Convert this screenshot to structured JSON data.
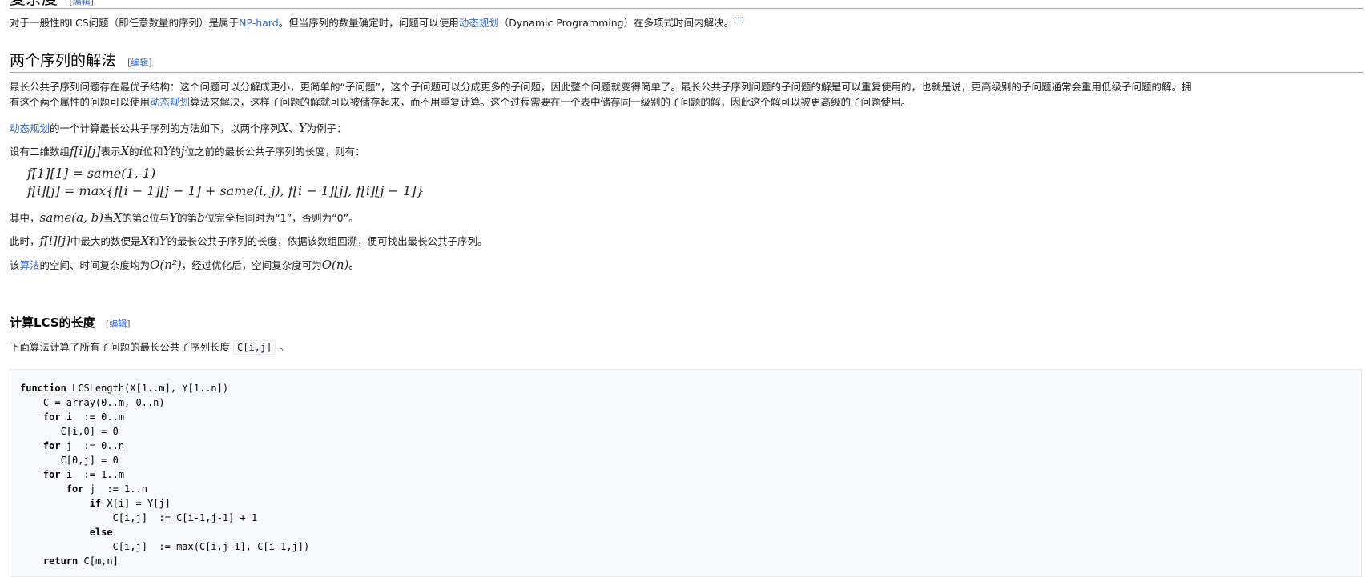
{
  "prev_heading": {
    "title": "复杂度",
    "edit": "编辑"
  },
  "complexity_para": {
    "t1": "对于一般性的LCS问题（即任意数量的序列）是属于",
    "link1": "NP-hard",
    "t2": "。但当序列的数量确定时，问题可以使用",
    "link2": "动态规划",
    "t3": "（Dynamic Programming）在多项式时间内解决。",
    "ref": "[1]"
  },
  "section2": {
    "title": "两个序列的解法",
    "edit": "编辑"
  },
  "para_structure": {
    "t1": "最长公共子序列问题存在最优子结构：这个问题可以分解成更小，更简单的“子问题”，这个子问题可以分成更多的子问题，因此整个问题就变得简单了。最长公共子序列问题的子问题的解是可以重复使用的，也就是说，更高级别的子问题通常会重用低级子问题的解。拥",
    "t2": "有这个两个属性的问题可以使用",
    "link": "动态规划",
    "t3": "算法来解决，这样子问题的解就可以被储存起来，而不用重复计算。这个过程需要在一个表中储存同一级别的子问题的解，因此这个解可以被更高级的子问题使用。"
  },
  "para_method": {
    "link": "动态规划",
    "t1": "的一个计算最长公共子序列的方法如下，以两个序列",
    "m1": "X",
    "t2": "、",
    "m2": "Y",
    "t3": "为例子："
  },
  "para_array": {
    "t1": "设有二维数组",
    "m1": "f[i][j]",
    "t2": "表示",
    "m2": "X",
    "t3": "的",
    "m3": "i",
    "t4": "位和",
    "m4": "Y",
    "t5": "的",
    "m5": "j",
    "t6": "位之前的最长公共子序列的长度，则有："
  },
  "formula": {
    "line1": "f[1][1] = same(1, 1)",
    "line2": "f[i][j] = max{f[i − 1][j − 1] + same(i, j), f[i − 1][j], f[i][j − 1]}"
  },
  "para_same": {
    "t1": "其中，",
    "m1": "same(a, b)",
    "t2": "当",
    "m2": "X",
    "t3": "的第",
    "m3": "a",
    "t4": "位与",
    "m4": "Y",
    "t5": "的第",
    "m5": "b",
    "t6": "位完全相同时为“1”，否则为“0”。"
  },
  "para_max": {
    "t1": "此时，",
    "m1": "f[i][j]",
    "t2": "中最大的数便是",
    "m2": "X",
    "t3": "和",
    "m3": "Y",
    "t4": "的最长公共子序列的长度，依据该数组回溯，便可找出最长公共子序列。"
  },
  "para_complexity": {
    "t1": "该",
    "link": "算法",
    "t2": "的空间、时间复杂度均为",
    "m1": "O(n²)",
    "t3": "，经过优化后，空间复杂度可为",
    "m2": "O(n)",
    "t4": "。"
  },
  "section3": {
    "title": "计算LCS的长度",
    "edit": "编辑"
  },
  "para_calc": {
    "t1": "下面算法计算了所有子问题的最长公共子序列长度",
    "code": "C[i,j]",
    "t2": "。"
  },
  "code_lines": [
    {
      "kw": "function",
      "rest": " LCSLength(X[1..m], Y[1..n])",
      "indent": ""
    },
    {
      "kw": "",
      "rest": "C = array(0..m, 0..n)",
      "indent": "    "
    },
    {
      "kw": "for",
      "rest": " i  := 0..m",
      "indent": "    "
    },
    {
      "kw": "",
      "rest": "C[i,0] = 0",
      "indent": "       "
    },
    {
      "kw": "for",
      "rest": " j  := 0..n",
      "indent": "    "
    },
    {
      "kw": "",
      "rest": "C[0,j] = 0",
      "indent": "       "
    },
    {
      "kw": "for",
      "rest": " i  := 1..m",
      "indent": "    "
    },
    {
      "kw": "for",
      "rest": " j  := 1..n",
      "indent": "        "
    },
    {
      "kw": "if",
      "rest": " X[i] = Y[j]",
      "indent": "            "
    },
    {
      "kw": "",
      "rest": "C[i,j]  := C[i-1,j-1] + 1",
      "indent": "                "
    },
    {
      "kw": "else",
      "rest": "",
      "indent": "            "
    },
    {
      "kw": "",
      "rest": "C[i,j]  := max(C[i,j-1], C[i-1,j])",
      "indent": "                "
    },
    {
      "kw": "return",
      "rest": " C[m,n]",
      "indent": "    "
    }
  ]
}
